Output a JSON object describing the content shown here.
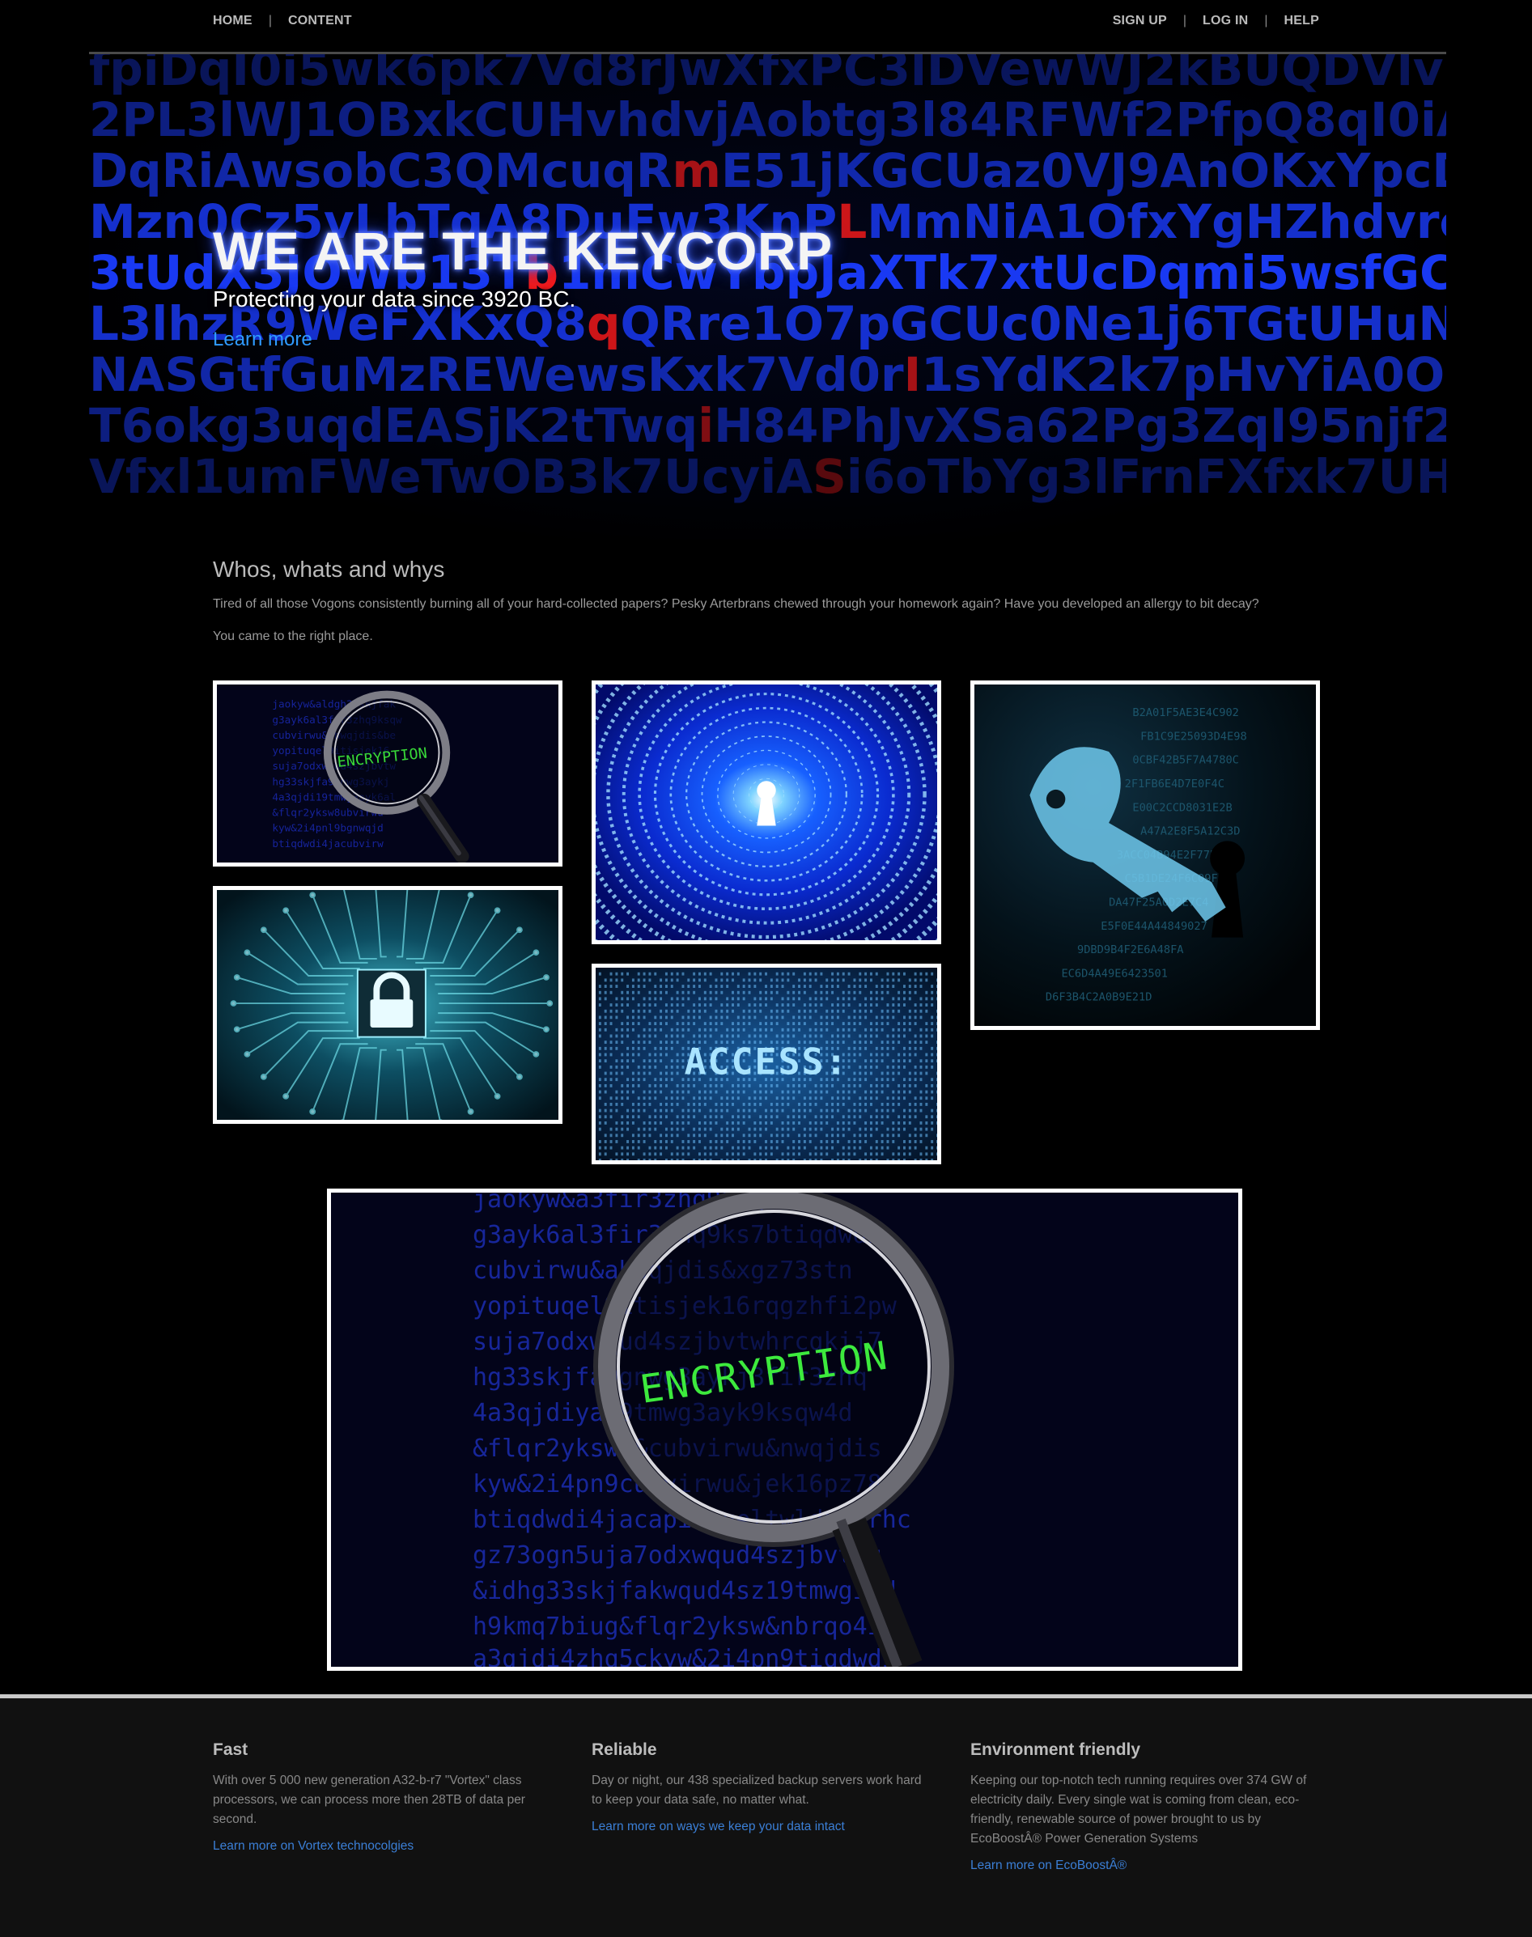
{
  "nav": {
    "left": [
      {
        "label": "HOME"
      },
      {
        "label": "CONTENT"
      }
    ],
    "right": [
      {
        "label": "SIGN UP"
      },
      {
        "label": "LOG IN"
      },
      {
        "label": "HELP"
      }
    ],
    "separator": "|"
  },
  "hero": {
    "title": "WE ARE THE KEYCORP",
    "subtitle": "Protecting your data since 3920 BC.",
    "link": "Learn more"
  },
  "intro": {
    "heading": "Whos, whats and whys",
    "paragraph1": "Tired of all those Vogons consistently burning all of your hard-collected papers? Pesky Arterbrans chewed through your homework again? Have you developed an allergy to bit decay?",
    "paragraph2": "You came to the right place."
  },
  "gallery": {
    "images": [
      {
        "icon": "magnifier-encryption-image",
        "caption": "ENCRYPTION"
      },
      {
        "icon": "binary-keyhole-tunnel-image"
      },
      {
        "icon": "digital-key-image"
      },
      {
        "icon": "circuit-padlock-image"
      },
      {
        "icon": "access-code-image",
        "caption": "ACCESS:"
      },
      {
        "icon": "magnifier-encryption-large-image",
        "caption": "ENCRYPTION"
      }
    ]
  },
  "footer": {
    "columns": [
      {
        "title": "Fast",
        "text": "With over 5 000 new generation A32-b-r7 \"Vortex\" class processors, we can process more then 28TB of data per second.",
        "link": "Learn more on Vortex technocolgies"
      },
      {
        "title": "Reliable",
        "text": "Day or night, our 438 specialized backup servers work hard to keep your data safe, no matter what.",
        "link": "Learn more on ways we keep your data intact"
      },
      {
        "title": "Environment friendly",
        "text": "Keeping our top-notch tech running requires over 374 GW of electricity daily. Every single wat is coming from clean, eco-friendly, renewable source of power brought to us by EcoBoostÂ® Power Generation Systems",
        "link": "Learn more on EcoBoostÂ®"
      }
    ]
  },
  "colors": {
    "background": "#000000",
    "link": "#2f9bff",
    "footerLink": "#3b7fd6",
    "heroCode": "#1a3cff",
    "heroHighlight": "#ff1a1a"
  }
}
